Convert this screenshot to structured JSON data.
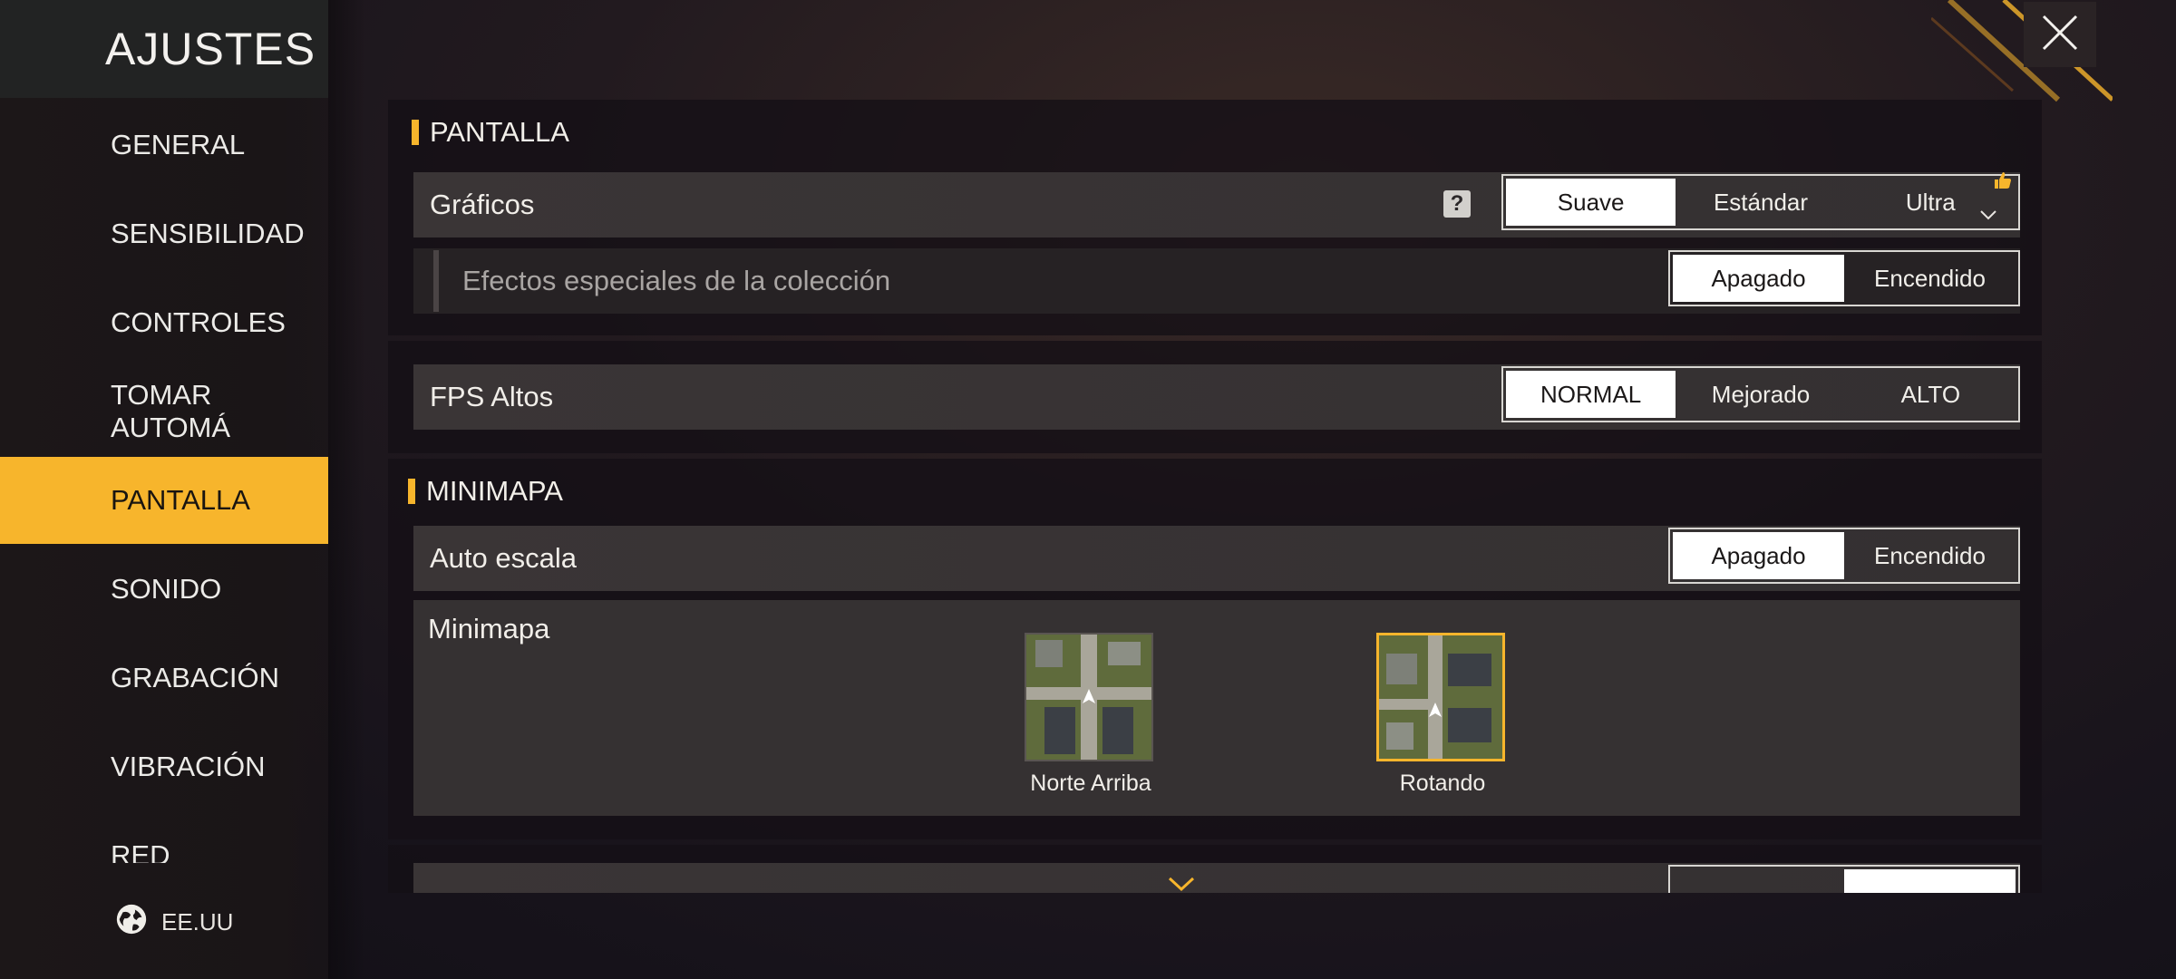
{
  "sidebar": {
    "title": "AJUSTES",
    "items": [
      {
        "label": "GENERAL"
      },
      {
        "label": "SENSIBILIDAD"
      },
      {
        "label": "CONTROLES"
      },
      {
        "label": "TOMAR AUTOMÁ"
      },
      {
        "label": "PANTALLA"
      },
      {
        "label": "SONIDO"
      },
      {
        "label": "GRABACIÓN"
      },
      {
        "label": "VIBRACIÓN"
      },
      {
        "label": "RED"
      }
    ],
    "active_index": 4,
    "region": "EE.UU"
  },
  "colors": {
    "accent": "#f7b52c",
    "selected_bg": "#ffffff"
  },
  "pantalla": {
    "title": "PANTALLA",
    "graficos": {
      "label": "Gráficos",
      "help": "?",
      "options": [
        "Suave",
        "Estándar",
        "Ultra"
      ],
      "selected": "Suave"
    },
    "efectos": {
      "label": "Efectos especiales de la colección",
      "options": [
        "Apagado",
        "Encendido"
      ],
      "selected": "Apagado"
    },
    "fps": {
      "label": "FPS Altos",
      "options": [
        "NORMAL",
        "Mejorado",
        "ALTO"
      ],
      "selected": "NORMAL"
    }
  },
  "minimapa": {
    "title": "MINIMAPA",
    "auto_escala": {
      "label": "Auto escala",
      "options": [
        "Apagado",
        "Encendido"
      ],
      "selected": "Apagado"
    },
    "minimapa_label": "Minimapa",
    "options": [
      {
        "caption": "Norte Arriba",
        "selected": false
      },
      {
        "caption": "Rotando",
        "selected": true
      }
    ]
  },
  "icons": {
    "close": "close-icon",
    "globe": "globe-icon",
    "thumb_up": "thumbs-up-icon",
    "expand": "chevron-down-icon"
  }
}
